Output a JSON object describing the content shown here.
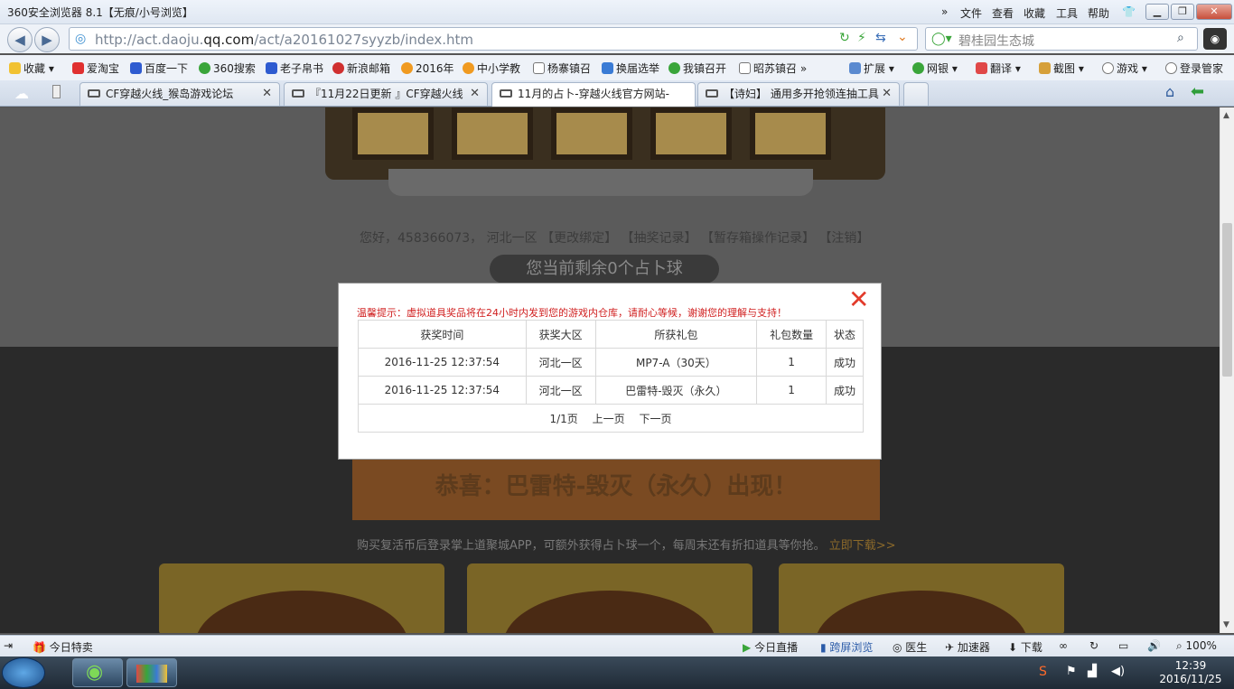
{
  "window": {
    "title": "360安全浏览器 8.1【无痕/小号浏览】",
    "menu": [
      "文件",
      "查看",
      "收藏",
      "工具",
      "帮助"
    ]
  },
  "address": {
    "url_pre": "http://act.daoju.",
    "url_domain": "qq.com",
    "url_post": "/act/a20161027syyzb/index.htm",
    "search_text": "碧桂园生态城"
  },
  "bookmarks": [
    "收藏",
    "爱淘宝",
    "百度一下",
    "360搜索",
    "老子帛书",
    "新浪邮箱",
    "2016年",
    "中小学教",
    "杨寨镇召",
    "换届选举",
    "我镇召开",
    "昭苏镇召"
  ],
  "toolbar_right": [
    "扩展",
    "网银",
    "翻译",
    "截图",
    "游戏",
    "登录管家"
  ],
  "tabs": [
    {
      "label": "CF穿越火线_猴岛游戏论坛"
    },
    {
      "label": "『11月22日更新 』CF穿越火线"
    },
    {
      "label": "11月的占卜-穿越火线官方网站-"
    },
    {
      "label": "【诗妇】 通用多开抢领连抽工具"
    }
  ],
  "page": {
    "hello_prefix": "您好，458366073， 河北一区",
    "hello_links": [
      "【更改绑定】",
      "【抽奖记录】",
      "【暂存箱操作记录】",
      "【注销】"
    ],
    "ball_count": "您当前剩余0个占卜球",
    "congrats": "恭喜：巴雷特-毁灭（永久）出现！",
    "promo": "购买复活币后登录掌上道聚城APP，可额外获得占卜球一个，每周末还有折扣道具等你抢。",
    "promo_link": "立即下载>>"
  },
  "modal": {
    "tip": "温馨提示：虚拟道具奖品将在24小时内发到您的游戏内仓库，请耐心等候，谢谢您的理解与支持！",
    "columns": [
      "获奖时间",
      "获奖大区",
      "所获礼包",
      "礼包数量",
      "状态"
    ],
    "rows": [
      [
        "2016-11-25 12:37:54",
        "河北一区",
        "MP7-A（30天）",
        "1",
        "成功"
      ],
      [
        "2016-11-25 12:37:54",
        "河北一区",
        "巴雷特-毁灭（永久）",
        "1",
        "成功"
      ]
    ],
    "page_info": "1/1页",
    "prev": "上一页",
    "next": "下一页"
  },
  "statusbar": {
    "left": "今日特卖",
    "items": [
      "今日直播",
      "跨屏浏览",
      "医生",
      "加速器",
      "下载"
    ],
    "zoom": "100%"
  },
  "taskbar": {
    "time": "12:39",
    "date": "2016/11/25"
  }
}
